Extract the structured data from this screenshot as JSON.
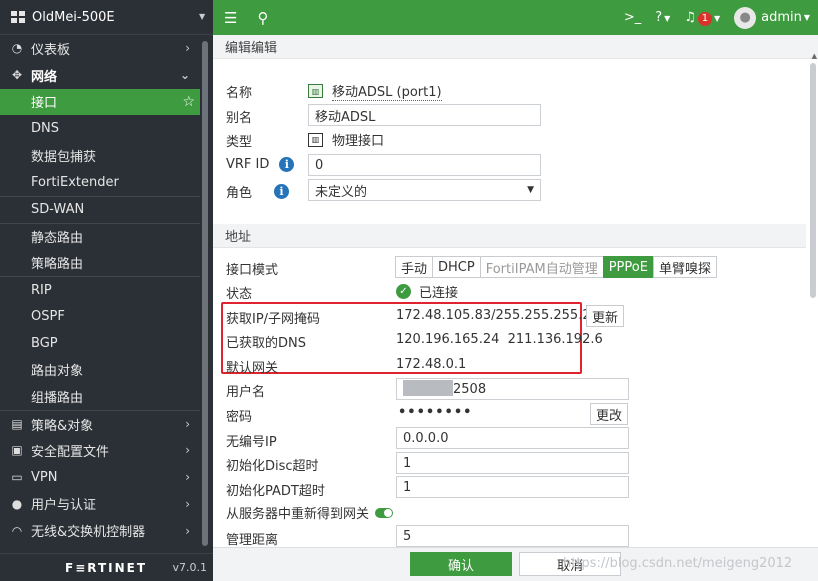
{
  "device": {
    "name": "OldMei-500E"
  },
  "sidebar": {
    "items": [
      {
        "label": "仪表板",
        "icon": "dashboard-icon",
        "type": "section-collapsed"
      },
      {
        "label": "网络",
        "icon": "network-icon",
        "type": "section-expanded"
      },
      {
        "label": "接口",
        "type": "sub-active"
      },
      {
        "label": "DNS",
        "type": "sub"
      },
      {
        "label": "数据包捕获",
        "type": "sub"
      },
      {
        "label": "FortiExtender",
        "type": "sub"
      },
      {
        "label": "SD-WAN",
        "type": "sub"
      },
      {
        "label": "静态路由",
        "type": "sub"
      },
      {
        "label": "策略路由",
        "type": "sub"
      },
      {
        "label": "RIP",
        "type": "sub"
      },
      {
        "label": "OSPF",
        "type": "sub"
      },
      {
        "label": "BGP",
        "type": "sub"
      },
      {
        "label": "路由对象",
        "type": "sub"
      },
      {
        "label": "组播路由",
        "type": "sub"
      },
      {
        "label": "策略&对象",
        "icon": "policy-icon",
        "type": "section-collapsed"
      },
      {
        "label": "安全配置文件",
        "icon": "lock-icon",
        "type": "section-collapsed"
      },
      {
        "label": "VPN",
        "icon": "monitor-icon",
        "type": "section-collapsed"
      },
      {
        "label": "用户与认证",
        "icon": "user-icon",
        "type": "section-collapsed"
      },
      {
        "label": "无线&交换机控制器",
        "icon": "wifi-icon",
        "type": "section-collapsed"
      }
    ],
    "brand": "F≡RTINET",
    "version": "v7.0.1"
  },
  "topbar": {
    "notification_count": "1",
    "user": "admin"
  },
  "page": {
    "section_edit": "编辑编辑",
    "name_label": "名称",
    "name_value": "移动ADSL (port1)",
    "alias_label": "别名",
    "alias_value": "移动ADSL",
    "type_label": "类型",
    "type_value": "物理接口",
    "vrf_label": "VRF ID",
    "vrf_value": "0",
    "role_label": "角色",
    "role_value": "未定义的",
    "section_address": "地址",
    "mode_label": "接口模式",
    "modes": [
      "手动",
      "DHCP",
      "FortiIPAM自动管理",
      "PPPoE",
      "单臂嗅探"
    ],
    "status_label": "状态",
    "status_value": "已连接",
    "ip_label": "获取IP/子网掩码",
    "ip_value": "172.48.105.83/255.255.255.255",
    "refresh_label": "更新",
    "dns_label": "已获取的DNS",
    "dns_value": "120.196.165.24  211.136.192.6",
    "gateway_label": "默认网关",
    "gateway_value": "172.48.0.1",
    "username_label": "用户名",
    "username_value": "2508",
    "password_label": "密码",
    "password_value": "••••••••",
    "change_label": "更改",
    "unnumbered_label": "无编号IP",
    "unnumbered_value": "0.0.0.0",
    "disc_label": "初始化Disc超时",
    "disc_value": "1",
    "padt_label": "初始化PADT超时",
    "padt_value": "1",
    "gateway_from_server_label": "从服务器中重新得到网关",
    "distance_label": "管理距离",
    "distance_value": "5"
  },
  "footer": {
    "ok_label": "确认",
    "cancel_label": "取消",
    "watermark": "https://blog.csdn.net/meigeng2012"
  }
}
